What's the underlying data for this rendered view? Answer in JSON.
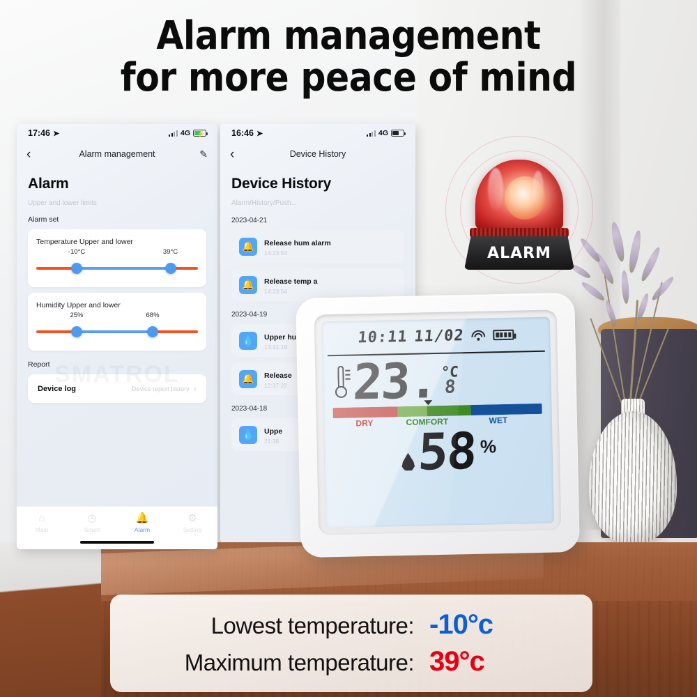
{
  "headline": {
    "line1": "Alarm management",
    "line2": "for more peace of mind"
  },
  "beacon": {
    "label": "ALARM"
  },
  "phone1": {
    "status": {
      "time": "17:46",
      "location_icon": "location-arrow-icon",
      "network": "4G",
      "battery_icon": "battery-charging-icon"
    },
    "nav": {
      "back_icon": "chevron-left-icon",
      "title": "Alarm management",
      "edit_icon": "pencil-icon"
    },
    "page_title": "Alarm",
    "page_subtitle": "Upper and lower limits",
    "section_label": "Alarm set",
    "temperature": {
      "title": "Temperature Upper and lower",
      "lower_value": "-10°C",
      "upper_value": "39°C",
      "lower_pct": 25,
      "upper_pct": 83
    },
    "humidity": {
      "title": "Humidity Upper and lower",
      "lower_value": "25%",
      "upper_value": "68%",
      "lower_pct": 25,
      "upper_pct": 72
    },
    "report_label": "Report",
    "device_log": {
      "label": "Device log",
      "value": "Device report history",
      "chevron": "›"
    },
    "watermark": "SMATROL",
    "tabs": [
      {
        "label": "Main",
        "icon": "home-icon",
        "glyph": "⌂",
        "active": false
      },
      {
        "label": "Smart",
        "icon": "clock-icon",
        "glyph": "◷",
        "active": false
      },
      {
        "label": "Alarm",
        "icon": "bell-icon",
        "glyph": "🔔",
        "active": true
      },
      {
        "label": "Setting",
        "icon": "gear-icon",
        "glyph": "⚙",
        "active": false
      }
    ]
  },
  "phone2": {
    "status": {
      "time": "16:46",
      "location_icon": "location-arrow-icon",
      "network": "4G",
      "battery_icon": "battery-icon"
    },
    "nav": {
      "back_icon": "chevron-left-icon",
      "title": "Device History"
    },
    "page_title": "Device History",
    "page_subtitle": "Alarm/History/Push...",
    "groups": [
      {
        "date": "2023-04-21",
        "items": [
          {
            "title": "Release hum alarm",
            "time": "14:23:54",
            "icon": "bell-icon",
            "glyph": "🔔"
          },
          {
            "title": "Release temp a",
            "time": "14:23:54",
            "icon": "bell-icon",
            "glyph": "🔔"
          }
        ]
      },
      {
        "date": "2023-04-19",
        "items": [
          {
            "title": "Upper hum",
            "time": "13:41:19",
            "icon": "droplet-icon",
            "glyph": "💧"
          },
          {
            "title": "Release",
            "time": "12:37:22",
            "icon": "bell-icon",
            "glyph": "🔔"
          }
        ]
      },
      {
        "date": "2023-04-18",
        "items": [
          {
            "title": "Uppe",
            "time": "21:38",
            "icon": "droplet-icon",
            "glyph": "💧"
          }
        ]
      }
    ]
  },
  "device": {
    "lcd": {
      "clock": "10:11",
      "date": "11/02",
      "wifi_icon": "wifi-icon",
      "battery_icon": "battery-full-icon",
      "temperature": "23.",
      "temperature_decimal": "8",
      "temperature_unit": "°C",
      "humidity": "58",
      "humidity_unit": "%",
      "comfort": {
        "dry_label": "DRY",
        "comfort_label": "COMFORT",
        "wet_label": "WET",
        "dry_color": "#c85e5a",
        "comfort_color_light": "#7db35a",
        "comfort_color_dark": "#3e8a23",
        "wet_color": "#14519a",
        "marker_pct": 46
      }
    }
  },
  "banner": {
    "rows": [
      {
        "label": "Lowest temperature:",
        "value": "-10°c",
        "color": "#0b5fd6"
      },
      {
        "label": "Maximum temperature:",
        "value": "39°c",
        "color": "#e60012"
      }
    ]
  },
  "colors": {
    "accent_blue": "#4e9af1",
    "accent_orange": "#f4511e",
    "alarm_red": "#c4201f"
  }
}
